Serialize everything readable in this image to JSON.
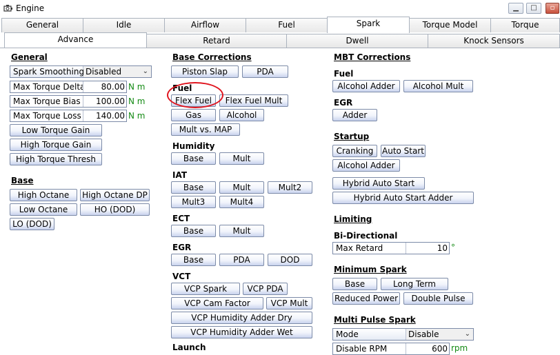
{
  "window": {
    "title": "Engine"
  },
  "tabs_main": [
    "General",
    "Idle",
    "Airflow",
    "Fuel",
    "Spark",
    "Torque Model",
    "Torque Managem"
  ],
  "tabs_sub": [
    "Advance",
    "Retard",
    "Dwell",
    "Knock Sensors"
  ],
  "general": {
    "title": "General",
    "spark_smoothing": {
      "label": "Spark Smoothing",
      "value": "Disabled"
    },
    "max_torque_delta": {
      "label": "Max Torque Delta",
      "value": "80.00",
      "unit": "N m"
    },
    "max_torque_bias": {
      "label": "Max Torque Bias",
      "value": "100.00",
      "unit": "N m"
    },
    "max_torque_loss": {
      "label": "Max Torque Loss",
      "value": "140.00",
      "unit": "N m"
    },
    "buttons": [
      "Low Torque Gain",
      "High Torque Gain",
      "High Torque Thresh"
    ]
  },
  "base": {
    "title": "Base",
    "buttons": [
      "High Octane",
      "High Octane DP",
      "Low Octane",
      "HO (DOD)",
      "LO (DOD)"
    ]
  },
  "base_corrections": {
    "title": "Base Corrections",
    "buttons": [
      "Piston Slap",
      "PDA"
    ],
    "fuel": {
      "title": "Fuel",
      "buttons": [
        "Flex Fuel",
        "Flex Fuel Mult",
        "Gas",
        "Alcohol",
        "Mult vs. MAP"
      ]
    },
    "humidity": {
      "title": "Humidity",
      "buttons": [
        "Base",
        "Mult"
      ]
    },
    "iat": {
      "title": "IAT",
      "buttons": [
        "Base",
        "Mult",
        "Mult2",
        "Mult3",
        "Mult4"
      ]
    },
    "ect": {
      "title": "ECT",
      "buttons": [
        "Base",
        "Mult"
      ]
    },
    "egr": {
      "title": "EGR",
      "buttons": [
        "Base",
        "PDA",
        "DOD"
      ]
    },
    "vct": {
      "title": "VCT",
      "buttons": [
        "VCP Spark",
        "VCP PDA",
        "VCP Cam Factor",
        "VCP Mult",
        "VCP Humidity Adder Dry",
        "VCP Humidity Adder Wet"
      ]
    },
    "launch": {
      "title": "Launch"
    }
  },
  "mbt": {
    "title": "MBT Corrections",
    "fuel": {
      "title": "Fuel",
      "buttons": [
        "Alcohol Adder",
        "Alcohol Mult"
      ]
    },
    "egr": {
      "title": "EGR",
      "buttons": [
        "Adder"
      ]
    }
  },
  "startup": {
    "title": "Startup",
    "buttons": [
      "Cranking",
      "Auto Start",
      "Alcohol Adder",
      "Hybrid Auto Start",
      "Hybrid Auto Start Adder"
    ]
  },
  "limiting": {
    "title": "Limiting",
    "bidir": {
      "title": "Bi-Directional",
      "max_retard": {
        "label": "Max Retard",
        "value": "10",
        "unit": "°"
      }
    }
  },
  "minimum_spark": {
    "title": "Minimum Spark",
    "buttons": [
      "Base",
      "Long Term",
      "Reduced Power",
      "Double Pulse"
    ]
  },
  "multi_pulse": {
    "title": "Multi Pulse Spark",
    "mode": {
      "label": "Mode",
      "value": "Disable"
    },
    "disable_rpm": {
      "label": "Disable RPM",
      "value": "600",
      "unit": "rpm"
    }
  }
}
